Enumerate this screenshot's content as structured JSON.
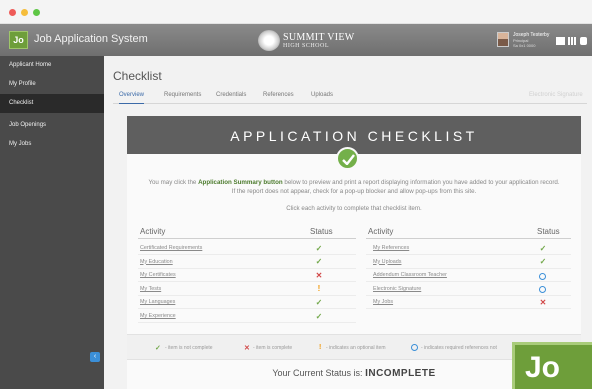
{
  "app": {
    "logo_text": "Jo",
    "title": "Job Application System",
    "school_name": "SUMMIT VIEW",
    "school_sub": "HIGH SCHOOL",
    "user_name": "Joseph Testerby",
    "user_sub_1": "Principal",
    "user_sub_2": "Sa 0x1 0000"
  },
  "sidebar": {
    "items": [
      {
        "label": "Applicant Home"
      },
      {
        "label": "My Profile"
      },
      {
        "label": "Checklist"
      },
      {
        "label": "Job Openings"
      },
      {
        "label": "My Jobs"
      }
    ],
    "collapse_glyph": "‹"
  },
  "page": {
    "title": "Checklist",
    "tabs": [
      {
        "label": "Overview"
      },
      {
        "label": "Requirements"
      },
      {
        "label": "Credentials"
      },
      {
        "label": "References"
      },
      {
        "label": "Uploads"
      },
      {
        "label": "Electronic Signature"
      }
    ]
  },
  "checklist": {
    "banner_title": "APPLICATION CHECKLIST",
    "intro_before": "You may click the ",
    "intro_bold": "Application Summary button",
    "intro_after": " below to preview and print a report displaying information you have added to your application record. If the report does not appear, check for a pop-up blocker and allow pop-ups from this site.",
    "click_each": "Click each activity to complete that checklist item.",
    "col_activity": "Activity",
    "col_status": "Status",
    "left": [
      {
        "label": "Certificated Requirements",
        "status": "complete"
      },
      {
        "label": "My Education",
        "status": "complete"
      },
      {
        "label": "My Certificates",
        "status": "incomplete"
      },
      {
        "label": "My Tests",
        "status": "optional"
      },
      {
        "label": "My Languages",
        "status": "complete"
      },
      {
        "label": "My Experience",
        "status": "complete"
      }
    ],
    "right": [
      {
        "label": "My References",
        "status": "complete"
      },
      {
        "label": "My Uploads",
        "status": "complete"
      },
      {
        "label": "Addendum Classroom Teacher",
        "status": "references"
      },
      {
        "label": "Electronic Signature",
        "status": "references"
      },
      {
        "label": "My Jobs",
        "status": "incomplete"
      }
    ],
    "glyphs": {
      "complete": "✓",
      "incomplete": "✕",
      "optional": "!"
    },
    "legend": [
      {
        "text": "- item is not complete"
      },
      {
        "text": "- item is complete"
      },
      {
        "text": "- indicates an optional item"
      },
      {
        "text": "- indicates required references not"
      }
    ],
    "status_label": "Your Current Status is:",
    "status_value": "INCOMPLETE"
  },
  "colors": {
    "green": "#72a84a",
    "red": "#d14747",
    "orange": "#f09a10",
    "blue": "#3b8fd8",
    "sidebar": "#4a4a4a"
  },
  "icons": [
    "shield-crest-icon",
    "user-avatar",
    "org-chart-icon",
    "grid-icon",
    "app-icon",
    "chevron-left-icon",
    "check-circle-icon"
  ]
}
